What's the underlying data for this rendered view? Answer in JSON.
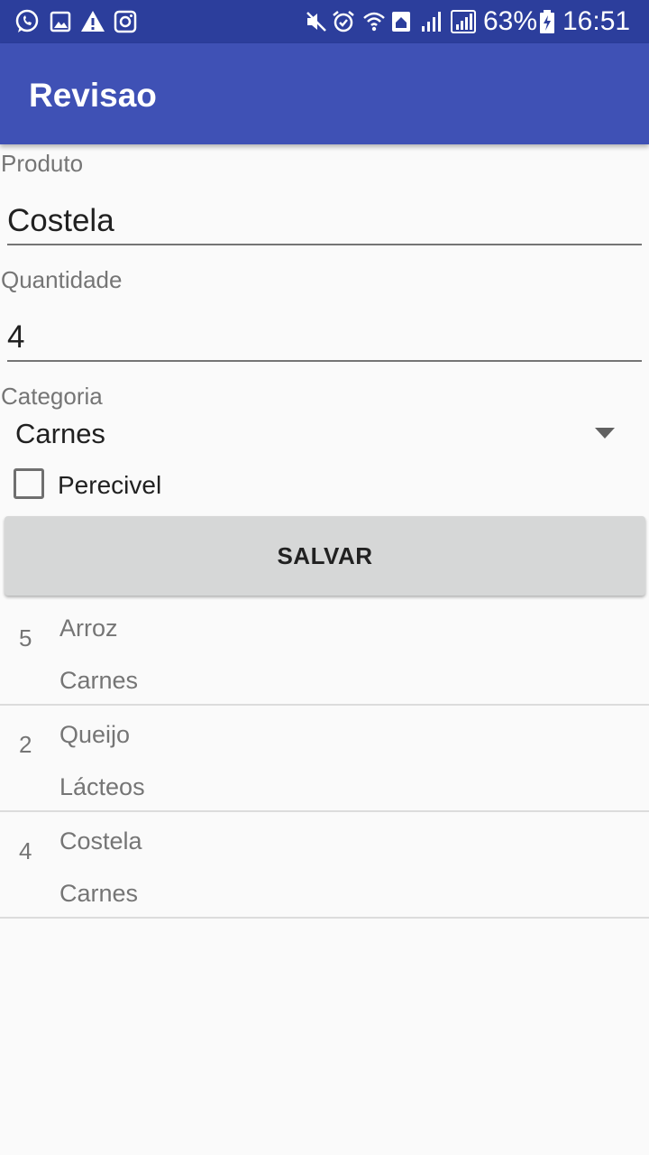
{
  "status_bar": {
    "battery": "63%",
    "time": "16:51",
    "left_icons": [
      "whatsapp-icon",
      "image-icon",
      "warning-icon",
      "instagram-icon"
    ],
    "right_icons": [
      "mute-icon",
      "alarm-icon",
      "wifi-icon",
      "signal-icon",
      "signal-icon",
      "battery-charging-icon"
    ]
  },
  "app_bar": {
    "title": "Revisao",
    "color": "#3f51b5",
    "status_color": "#2c3e9c"
  },
  "form": {
    "product_label": "Produto",
    "product_value": "Costela",
    "quantity_label": "Quantidade",
    "quantity_value": "4",
    "category_label": "Categoria",
    "category_value": "Carnes",
    "perishable_label": "Perecivel",
    "perishable_checked": false,
    "save_label": "SALVAR"
  },
  "items": [
    {
      "quantity": "5",
      "name": "Arroz",
      "category": "Carnes"
    },
    {
      "quantity": "2",
      "name": "Queijo",
      "category": "Lácteos"
    },
    {
      "quantity": "4",
      "name": "Costela",
      "category": "Carnes"
    }
  ]
}
